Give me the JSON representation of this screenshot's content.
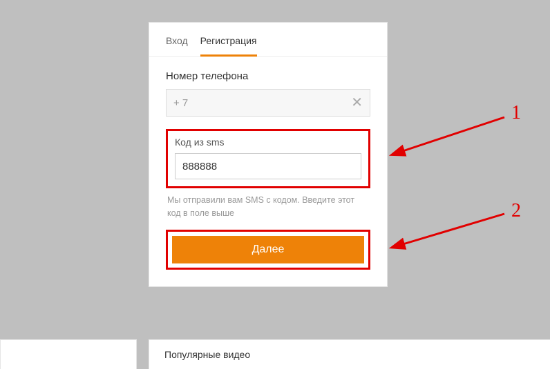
{
  "tabs": {
    "login": "Вход",
    "register": "Регистрация"
  },
  "phone": {
    "label": "Номер телефона",
    "prefix": "+ 7"
  },
  "sms": {
    "label": "Код из sms",
    "value": "888888",
    "hint": "Мы отправили вам SMS с кодом. Введите этот код в поле выше"
  },
  "button": {
    "next": "Далее"
  },
  "annotations": {
    "one": "1",
    "two": "2"
  },
  "bottom": {
    "popular": "Популярные видео"
  }
}
